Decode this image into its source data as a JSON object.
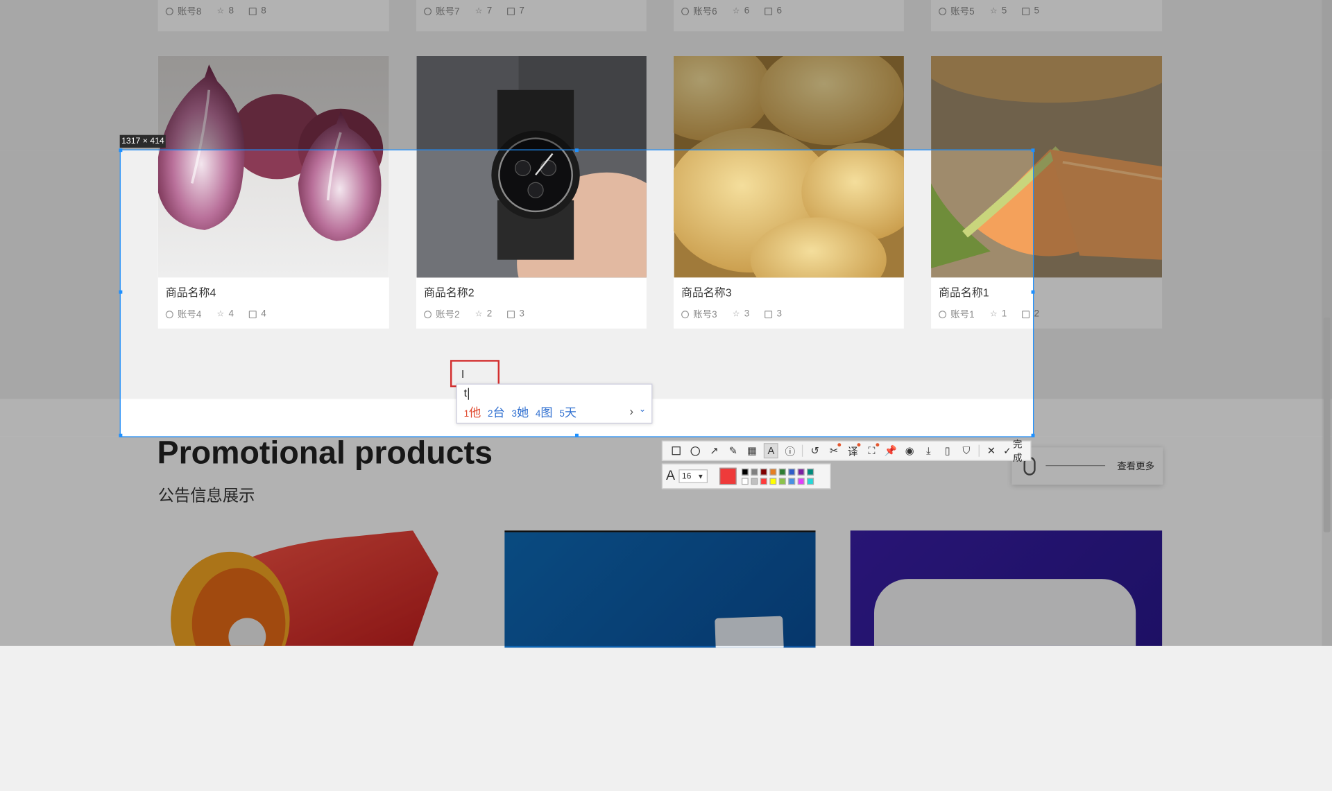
{
  "top_row": [
    {
      "account": "账号8",
      "stars": "8",
      "comments": "8"
    },
    {
      "account": "账号7",
      "stars": "7",
      "comments": "7"
    },
    {
      "account": "账号6",
      "stars": "6",
      "comments": "6"
    },
    {
      "account": "账号5",
      "stars": "5",
      "comments": "5"
    }
  ],
  "products": [
    {
      "name": "商品名称4",
      "account": "账号4",
      "stars": "4",
      "comments": "4"
    },
    {
      "name": "商品名称2",
      "account": "账号2",
      "stars": "2",
      "comments": "3"
    },
    {
      "name": "商品名称3",
      "account": "账号3",
      "stars": "3",
      "comments": "3"
    },
    {
      "name": "商品名称1",
      "account": "账号1",
      "stars": "1",
      "comments": "2"
    }
  ],
  "section": {
    "title": "Promotional products",
    "subtitle": "公告信息展示",
    "more_label": "查看更多"
  },
  "selection_size": "1317 × 414",
  "ime": {
    "typed": "t",
    "candidates": [
      {
        "num": "1",
        "text": "他"
      },
      {
        "num": "2",
        "text": "台"
      },
      {
        "num": "3",
        "text": "她"
      },
      {
        "num": "4",
        "text": "图"
      },
      {
        "num": "5",
        "text": "天"
      }
    ]
  },
  "screenshot_toolbar": {
    "done_label": "完成",
    "font_size": "16",
    "active_color": "#ee3a3a",
    "palette_top": [
      "#000000",
      "#808080",
      "#800000",
      "#e67e22",
      "#2e7d32",
      "#2e5cc9",
      "#7b1fa2",
      "#00897b"
    ],
    "palette_bottom": [
      "#ffffff",
      "#c0c0c0",
      "#ff3b3b",
      "#ffff00",
      "#8bc34a",
      "#4a90e2",
      "#e040fb",
      "#26d7d7"
    ]
  }
}
